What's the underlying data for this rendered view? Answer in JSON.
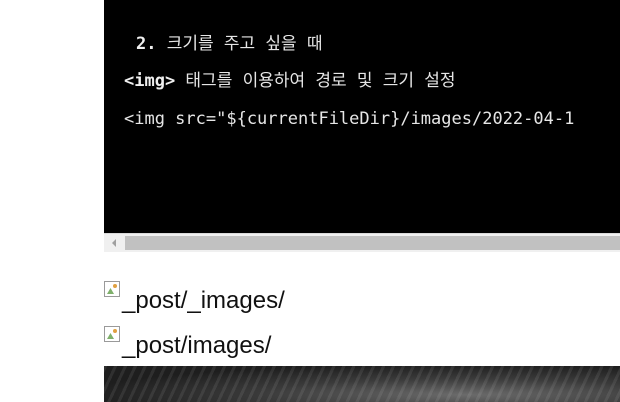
{
  "code_block": {
    "lines": [
      "2. 크기를 주고 싶을 때",
      "<img> 태그를 이용하여 경로 및 크기 설정",
      "<img src=\"${currentFileDir}/images/2022-04-1"
    ],
    "line2_tag": "<img>",
    "line2_rest": " 태그를 이용하여 경로 및 크기 설정",
    "line1_num": "2.",
    "line1_rest": " 크기를 주고 싶을 때"
  },
  "scrollbar": {
    "left_arrow_icon": "chevron-left-icon"
  },
  "images": [
    {
      "alt": "_post/_images/"
    },
    {
      "alt": "_post/images/"
    }
  ],
  "colors": {
    "code_bg": "#000000",
    "code_text": "#e6e6e6",
    "scroll_thumb": "#c1c1c1"
  }
}
